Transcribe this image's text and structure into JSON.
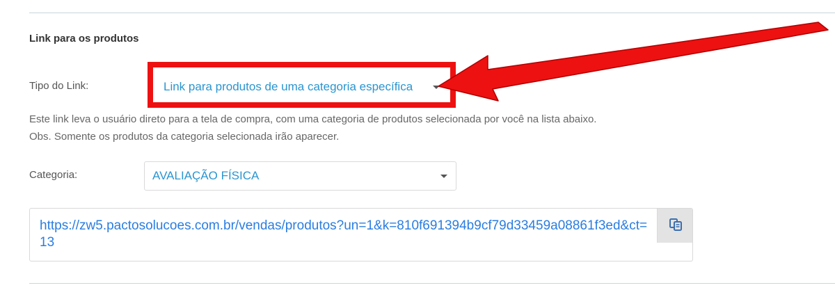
{
  "section": {
    "title": "Link para os produtos"
  },
  "tipo_link": {
    "label": "Tipo do Link:",
    "selected": "Link para produtos de uma categoria específica"
  },
  "help": {
    "line1": "Este link leva o usuário direto para a tela de compra, com uma categoria de produtos selecionada por você na lista abaixo.",
    "line2": "Obs. Somente os produtos da categoria selecionada irão aparecer."
  },
  "categoria": {
    "label": "Categoria:",
    "selected": "AVALIAÇÃO FÍSICA"
  },
  "generated_link": {
    "url": "https://zw5.pactosolucoes.com.br/vendas/produtos?un=1&k=810f691394b9cf79d33459a08861f3ed&ct=13"
  },
  "icons": {
    "copy": "copy-icon",
    "caret": "caret-down-icon"
  },
  "colors": {
    "accent": "#2a95d0",
    "link": "#2a7de0",
    "annotation": "#ee1111"
  }
}
